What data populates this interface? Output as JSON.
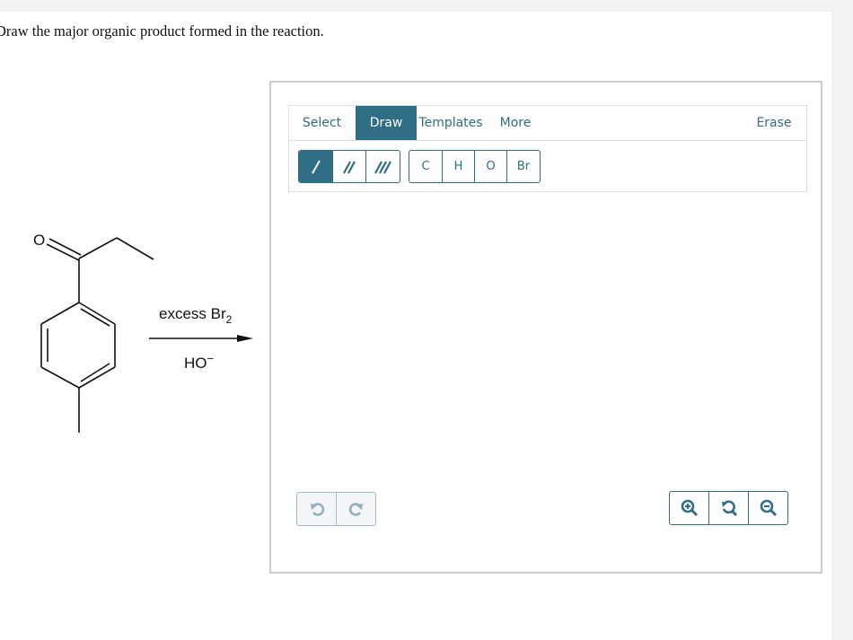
{
  "question": {
    "prompt": "Draw the major organic product formed in the reaction."
  },
  "reaction": {
    "reactant": "1-(4-methylphenyl)propan-1-one",
    "oxygen_label": "O",
    "reagent_top": "excess Br",
    "reagent_top_subscript": "2",
    "reagent_bottom": "HO",
    "reagent_bottom_charge": "−"
  },
  "editor": {
    "tabs": [
      {
        "label": "Select",
        "active": false
      },
      {
        "label": "Draw",
        "active": true
      },
      {
        "label": "Templates",
        "active": false
      },
      {
        "label": "More",
        "active": false
      }
    ],
    "erase_label": "Erase",
    "bond_tools": [
      {
        "icon": "single-bond-icon",
        "active": true
      },
      {
        "icon": "double-bond-icon",
        "active": false
      },
      {
        "icon": "triple-bond-icon",
        "active": false
      }
    ],
    "atoms": [
      "C",
      "H",
      "O",
      "Br"
    ],
    "history": {
      "undo_icon": "undo-icon",
      "redo_icon": "redo-icon",
      "disabled": true
    },
    "zoom_controls": {
      "zoom_in_icon": "zoom-in-icon",
      "reset_icon": "zoom-reset-icon",
      "zoom_out_icon": "zoom-out-icon"
    }
  },
  "colors": {
    "accent": "#2f6e84",
    "border": "#cccccc",
    "page_bg": "#f2f2f2"
  }
}
